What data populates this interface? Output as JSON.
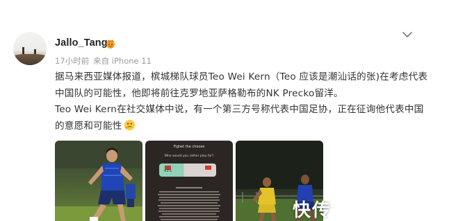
{
  "post": {
    "username": "Jallo_Tang",
    "badge_icon": "vip-crown-icon",
    "timestamp": "17小时前",
    "source": "来自 iPhone 11",
    "paragraphs": [
      "据马来西亚媒体报道，槟城梯队球员Teo Wei Kern（Teo 应该是潮汕话的张)在考虑代表中国队的可能性，他即将前往克罗地亚萨格勒布的NK Precko留洋。",
      "Teo Wei Kern在社交媒体中说，有一个第三方号称代表中国足协，正在征询他代表中国的意愿和可能性"
    ],
    "inline_emoji": "thinking-emoji-icon",
    "more_icon": "chevron-down-icon"
  },
  "images": [
    {
      "name": "football-player-photo"
    },
    {
      "name": "poll-screenshot",
      "title": "Fighet the choose",
      "poll_percent": "43%",
      "poll_question": "Who would you rather play for?"
    },
    {
      "name": "football-match-photo"
    }
  ],
  "watermark": "快传"
}
